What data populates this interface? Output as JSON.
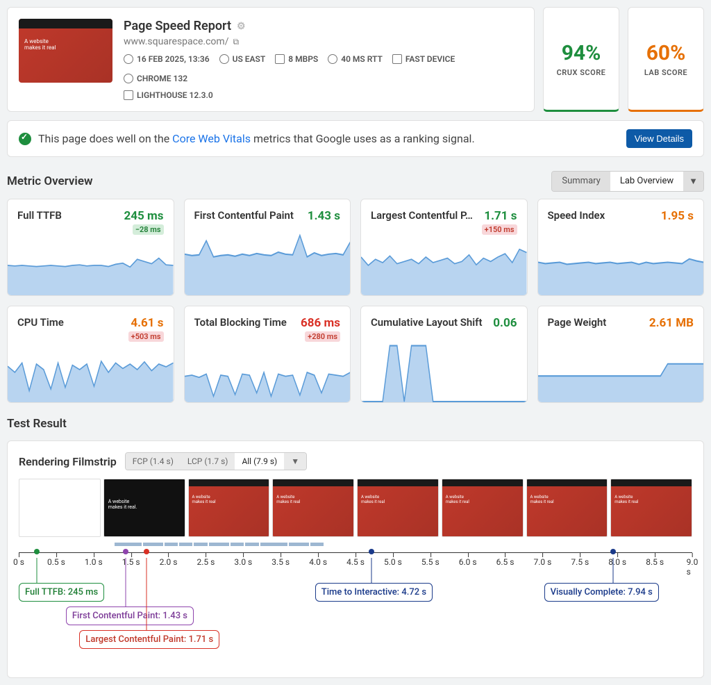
{
  "report": {
    "title": "Page Speed Report",
    "url": "www.squarespace.com/",
    "meta": {
      "timestamp": "16 FEB 2025, 13:36",
      "region": "US EAST",
      "bandwidth": "8 MBPS",
      "latency": "40 MS RTT",
      "device": "FAST DEVICE",
      "browser": "CHROME 132",
      "lighthouse": "LIGHTHOUSE 12.3.0"
    }
  },
  "scores": {
    "crux": {
      "value": "94%",
      "label": "CRUX SCORE"
    },
    "lab": {
      "value": "60%",
      "label": "LAB SCORE"
    }
  },
  "vitals": {
    "prefix": "This page does well on the ",
    "link": "Core Web Vitals",
    "suffix": " metrics that Google uses as a ranking signal.",
    "button": "View Details"
  },
  "overview": {
    "title": "Metric Overview",
    "tabs": {
      "summary": "Summary",
      "lab": "Lab Overview"
    }
  },
  "metrics": [
    {
      "name": "Full TTFB",
      "value": "245 ms",
      "color": "green",
      "delta": "−28 ms",
      "deltaType": "good"
    },
    {
      "name": "First Contentful Paint",
      "value": "1.43 s",
      "color": "green",
      "delta": "",
      "deltaType": ""
    },
    {
      "name": "Largest Contentful P…",
      "value": "1.71 s",
      "color": "green",
      "delta": "+150 ms",
      "deltaType": "bad"
    },
    {
      "name": "Speed Index",
      "value": "1.95 s",
      "color": "orange",
      "delta": "",
      "deltaType": ""
    },
    {
      "name": "CPU Time",
      "value": "4.61 s",
      "color": "orange",
      "delta": "+503 ms",
      "deltaType": "bad"
    },
    {
      "name": "Total Blocking Time",
      "value": "686 ms",
      "color": "red",
      "delta": "+280 ms",
      "deltaType": "bad"
    },
    {
      "name": "Cumulative Layout Shift",
      "value": "0.06",
      "color": "green",
      "delta": "",
      "deltaType": ""
    },
    {
      "name": "Page Weight",
      "value": "2.61 MB",
      "color": "orange",
      "delta": "",
      "deltaType": ""
    }
  ],
  "testResult": {
    "title": "Test Result"
  },
  "filmstrip": {
    "title": "Rendering Filmstrip",
    "tabs": {
      "fcp": "FCP (1.4 s)",
      "lcp": "LCP (1.7 s)",
      "all": "All (7.9 s)"
    }
  },
  "timeline": {
    "ticks": [
      "0 s",
      "0.5 s",
      "1.0 s",
      "1.5 s",
      "2.0 s",
      "2.5 s",
      "3.0 s",
      "3.5 s",
      "4.0 s",
      "4.5 s",
      "5.0 s",
      "5.5 s",
      "6.0 s",
      "6.5 s",
      "7.0 s",
      "7.5 s",
      "8.0 s",
      "8.5 s",
      "9.0 s"
    ],
    "markers": {
      "ttfb": {
        "label": "Full TTFB: 245 ms",
        "pos": 2.7,
        "color": "#1e8e3e"
      },
      "fcp": {
        "label": "First Contentful Paint: 1.43 s",
        "pos": 15.9,
        "color": "#8e44ad"
      },
      "lcp": {
        "label": "Largest Contentful Paint: 1.71 s",
        "pos": 19.0,
        "color": "#d93025"
      },
      "tti": {
        "label": "Time to Interactive: 4.72 s",
        "pos": 52.4,
        "color": "#1a3a8a"
      },
      "vc": {
        "label": "Visually Complete: 7.94 s",
        "pos": 88.2,
        "color": "#1a3a8a"
      }
    }
  },
  "chart_data": [
    {
      "type": "line",
      "title": "Full TTFB sparkline",
      "ylim": [
        0,
        1
      ],
      "values": [
        0.55,
        0.54,
        0.55,
        0.54,
        0.53,
        0.54,
        0.55,
        0.54,
        0.53,
        0.55,
        0.56,
        0.54,
        0.55,
        0.55,
        0.53,
        0.57,
        0.59,
        0.52,
        0.66,
        0.62,
        0.58,
        0.68,
        0.56,
        0.55
      ]
    },
    {
      "type": "line",
      "title": "FCP sparkline",
      "ylim": [
        0,
        1
      ],
      "values": [
        0.62,
        0.6,
        0.61,
        0.82,
        0.58,
        0.6,
        0.61,
        0.59,
        0.62,
        0.6,
        0.63,
        0.61,
        0.6,
        0.65,
        0.62,
        0.61,
        0.9,
        0.58,
        0.64,
        0.6,
        0.62,
        0.63,
        0.61,
        0.8
      ]
    },
    {
      "type": "line",
      "title": "LCP sparkline",
      "ylim": [
        0,
        1
      ],
      "values": [
        0.7,
        0.55,
        0.66,
        0.6,
        0.72,
        0.58,
        0.62,
        0.66,
        0.58,
        0.7,
        0.6,
        0.64,
        0.68,
        0.58,
        0.62,
        0.74,
        0.56,
        0.68,
        0.62,
        0.7,
        0.76,
        0.6,
        0.84,
        0.78
      ]
    },
    {
      "type": "line",
      "title": "Speed Index sparkline",
      "ylim": [
        0,
        1
      ],
      "values": [
        0.5,
        0.48,
        0.49,
        0.5,
        0.47,
        0.48,
        0.49,
        0.5,
        0.48,
        0.49,
        0.5,
        0.48,
        0.49,
        0.5,
        0.47,
        0.5,
        0.48,
        0.49,
        0.5,
        0.49,
        0.48,
        0.55,
        0.52,
        0.5
      ]
    },
    {
      "type": "line",
      "title": "CPU Time sparkline",
      "ylim": [
        0,
        1
      ],
      "values": [
        0.66,
        0.55,
        0.72,
        0.22,
        0.7,
        0.6,
        0.25,
        0.72,
        0.28,
        0.68,
        0.6,
        0.7,
        0.3,
        0.75,
        0.55,
        0.72,
        0.62,
        0.7,
        0.6,
        0.74,
        0.58,
        0.7,
        0.65,
        0.72
      ]
    },
    {
      "type": "line",
      "title": "TBT sparkline",
      "ylim": [
        0,
        1
      ],
      "values": [
        0.48,
        0.5,
        0.46,
        0.52,
        0.12,
        0.5,
        0.48,
        0.15,
        0.52,
        0.5,
        0.18,
        0.55,
        0.12,
        0.52,
        0.48,
        0.5,
        0.14,
        0.55,
        0.5,
        0.18,
        0.52,
        0.5,
        0.48,
        0.55
      ]
    },
    {
      "type": "line",
      "title": "CLS sparkline",
      "ylim": [
        0,
        1
      ],
      "values": [
        0.02,
        0.02,
        0.02,
        0.02,
        0.85,
        0.85,
        0.02,
        0.85,
        0.85,
        0.85,
        0.02,
        0.02,
        0.02,
        0.02,
        0.02,
        0.02,
        0.02,
        0.02,
        0.02,
        0.02,
        0.02,
        0.02,
        0.02,
        0.02
      ]
    },
    {
      "type": "line",
      "title": "Page Weight sparkline",
      "ylim": [
        0,
        1
      ],
      "values": [
        0.4,
        0.4,
        0.4,
        0.4,
        0.4,
        0.4,
        0.4,
        0.4,
        0.4,
        0.4,
        0.4,
        0.4,
        0.4,
        0.4,
        0.4,
        0.4,
        0.4,
        0.4,
        0.58,
        0.58,
        0.58,
        0.58,
        0.58,
        0.58
      ]
    }
  ]
}
